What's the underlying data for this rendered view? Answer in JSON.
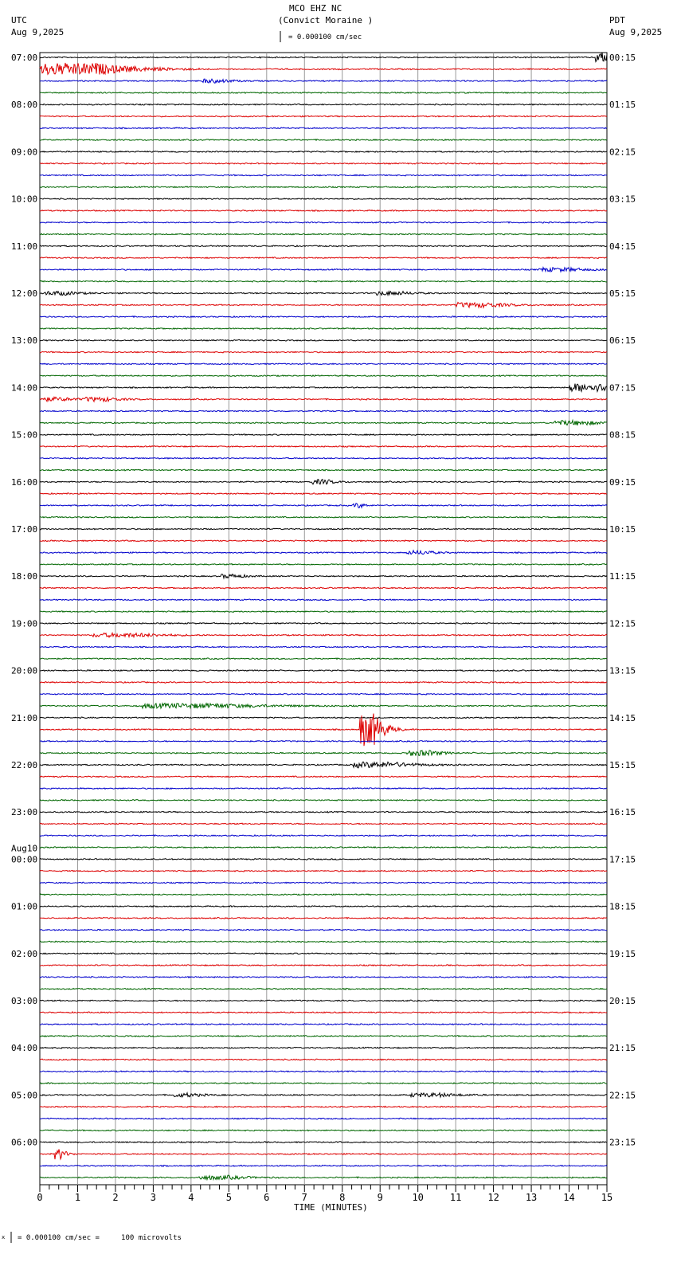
{
  "header": {
    "station": "MCO EHZ NC",
    "location": "(Convict Moraine )",
    "left_tz": "UTC",
    "left_date": "Aug 9,2025",
    "right_tz": "PDT",
    "right_date": "Aug 9,2025",
    "scale": "= 0.000100 cm/sec"
  },
  "footer": {
    "scale": "= 0.000100 cm/sec =     100 microvolts",
    "mark": "x"
  },
  "chart_data": {
    "type": "line",
    "title": "MCO EHZ NC (Convict Moraine )",
    "xlabel": "TIME (MINUTES)",
    "xlim": [
      0,
      15
    ],
    "xticks": [
      "0",
      "1",
      "2",
      "3",
      "4",
      "5",
      "6",
      "7",
      "8",
      "9",
      "10",
      "11",
      "12",
      "13",
      "14",
      "15"
    ],
    "trace_colors": [
      "#000000",
      "#dd0000",
      "#0000cc",
      "#006600"
    ],
    "traces_per_hour": 4,
    "left_labels": [
      "07:00",
      "08:00",
      "09:00",
      "10:00",
      "11:00",
      "12:00",
      "13:00",
      "14:00",
      "15:00",
      "16:00",
      "17:00",
      "18:00",
      "19:00",
      "20:00",
      "21:00",
      "22:00",
      "23:00",
      "00:00",
      "01:00",
      "02:00",
      "03:00",
      "04:00",
      "05:00",
      "06:00"
    ],
    "date_change_label": "Aug10",
    "right_labels": [
      "00:15",
      "01:15",
      "02:15",
      "03:15",
      "04:15",
      "05:15",
      "06:15",
      "07:15",
      "08:15",
      "09:15",
      "10:15",
      "11:15",
      "12:15",
      "13:15",
      "14:15",
      "15:15",
      "16:15",
      "17:15",
      "18:15",
      "19:15",
      "20:15",
      "21:15",
      "22:15",
      "23:15"
    ],
    "events": [
      {
        "trace": 1,
        "start": 0,
        "dur": 1.5,
        "amp": 14
      },
      {
        "trace": 0,
        "start": 14.7,
        "dur": 0.3,
        "amp": 12
      },
      {
        "trace": 2,
        "start": 4.3,
        "dur": 0.5,
        "amp": 4
      },
      {
        "trace": 18,
        "start": 13.2,
        "dur": 0.8,
        "amp": 4
      },
      {
        "trace": 20,
        "start": 0.1,
        "dur": 0.6,
        "amp": 4
      },
      {
        "trace": 20,
        "start": 8.9,
        "dur": 0.6,
        "amp": 4
      },
      {
        "trace": 21,
        "start": 11,
        "dur": 0.9,
        "amp": 5
      },
      {
        "trace": 29,
        "start": 1.2,
        "dur": 0.6,
        "amp": 4
      },
      {
        "trace": 28,
        "start": 14,
        "dur": 1,
        "amp": 9
      },
      {
        "trace": 29,
        "start": 0,
        "dur": 0.6,
        "amp": 4
      },
      {
        "trace": 31,
        "start": 13.6,
        "dur": 0.8,
        "amp": 5
      },
      {
        "trace": 36,
        "start": 7.2,
        "dur": 0.4,
        "amp": 5
      },
      {
        "trace": 38,
        "start": 8.3,
        "dur": 0.2,
        "amp": 5
      },
      {
        "trace": 42,
        "start": 9.7,
        "dur": 0.5,
        "amp": 4
      },
      {
        "trace": 44,
        "start": 4.8,
        "dur": 0.4,
        "amp": 4
      },
      {
        "trace": 49,
        "start": 1.4,
        "dur": 1.2,
        "amp": 4
      },
      {
        "trace": 55,
        "start": 2.7,
        "dur": 2,
        "amp": 5
      },
      {
        "trace": 57,
        "start": 8.45,
        "dur": 0.4,
        "amp": 40
      },
      {
        "trace": 59,
        "start": 9.7,
        "dur": 0.6,
        "amp": 6
      },
      {
        "trace": 60,
        "start": 8.3,
        "dur": 1,
        "amp": 6
      },
      {
        "trace": 88,
        "start": 3.5,
        "dur": 0.5,
        "amp": 4
      },
      {
        "trace": 88,
        "start": 9.8,
        "dur": 0.8,
        "amp": 4
      },
      {
        "trace": 93,
        "start": 0.38,
        "dur": 0.2,
        "amp": 12
      },
      {
        "trace": 95,
        "start": 4.2,
        "dur": 0.8,
        "amp": 4
      }
    ]
  }
}
